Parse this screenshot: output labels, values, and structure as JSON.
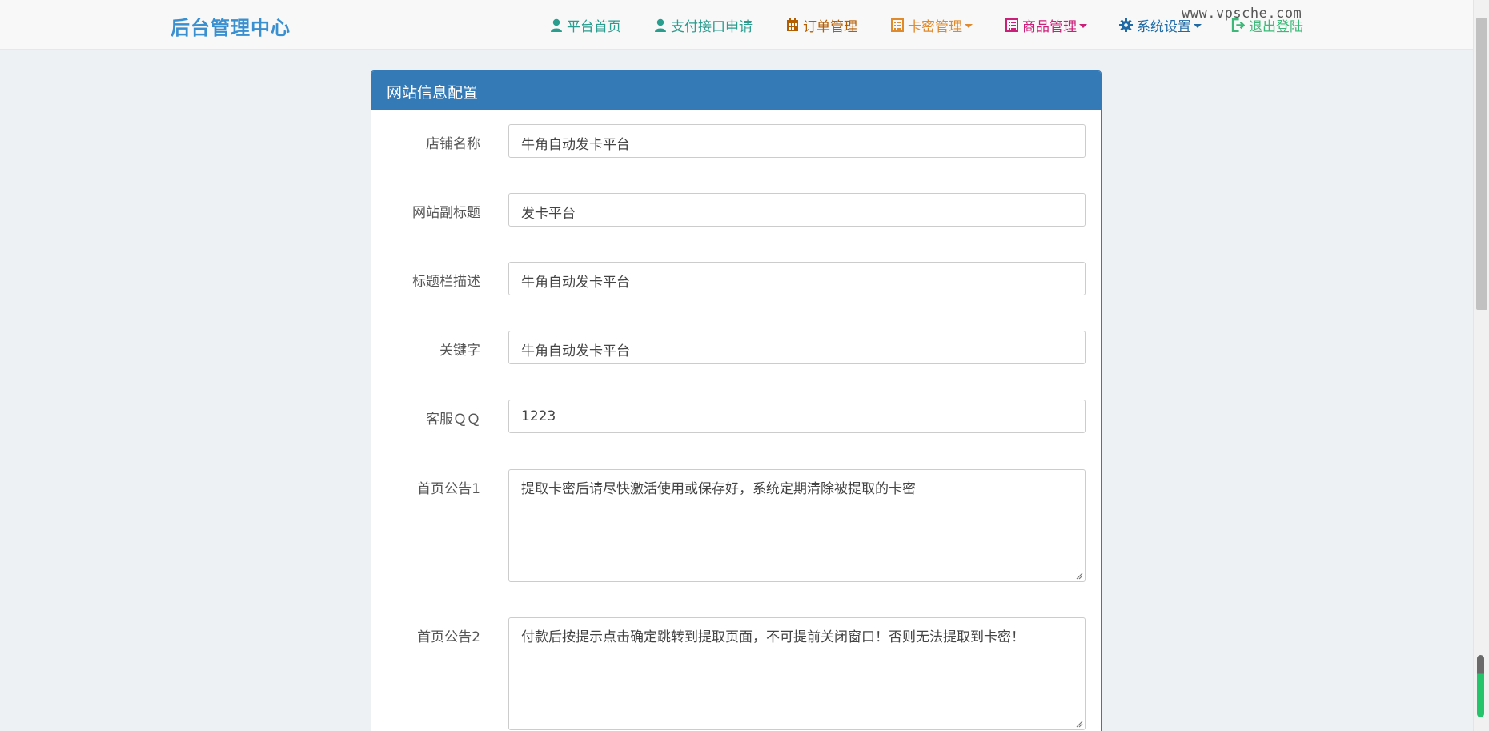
{
  "brand": "后台管理中心",
  "watermark": "www.vpsche.com",
  "nav": [
    {
      "label": "平台首页",
      "icon": "user-icon",
      "color": "#2a9d8f",
      "dropdown": false
    },
    {
      "label": "支付接口申请",
      "icon": "user-icon",
      "color": "#2a9d8f",
      "dropdown": false
    },
    {
      "label": "订单管理",
      "icon": "calendar-icon",
      "color": "#b35c00",
      "dropdown": false
    },
    {
      "label": "卡密管理",
      "icon": "list-icon",
      "color": "#e08a2c",
      "dropdown": true
    },
    {
      "label": "商品管理",
      "icon": "list-icon",
      "color": "#cc1f7a",
      "dropdown": true
    },
    {
      "label": "系统设置",
      "icon": "gear-icon",
      "color": "#1f6aa5",
      "dropdown": true
    },
    {
      "label": "退出登陆",
      "icon": "logout-icon",
      "color": "#3cb878",
      "dropdown": false
    }
  ],
  "panel": {
    "title": "网站信息配置",
    "fields": [
      {
        "label": "店铺名称",
        "value": "牛角自动发卡平台",
        "type": "input"
      },
      {
        "label": "网站副标题",
        "value": "发卡平台",
        "type": "input"
      },
      {
        "label": "标题栏描述",
        "value": "牛角自动发卡平台",
        "type": "input"
      },
      {
        "label": "关键字",
        "value": "牛角自动发卡平台",
        "type": "input"
      },
      {
        "label": "客服ＱＱ",
        "value": "1223",
        "type": "input"
      },
      {
        "label": "首页公告1",
        "value": "提取卡密后请尽快激活使用或保存好，系统定期清除被提取的卡密",
        "type": "textarea"
      },
      {
        "label": "首页公告2",
        "value": "付款后按提示点击确定跳转到提取页面，不可提前关闭窗口！否则无法提取到卡密！",
        "type": "textarea"
      }
    ]
  },
  "colors": {
    "primary": "#337ab7",
    "brand": "#3a8fd0"
  }
}
